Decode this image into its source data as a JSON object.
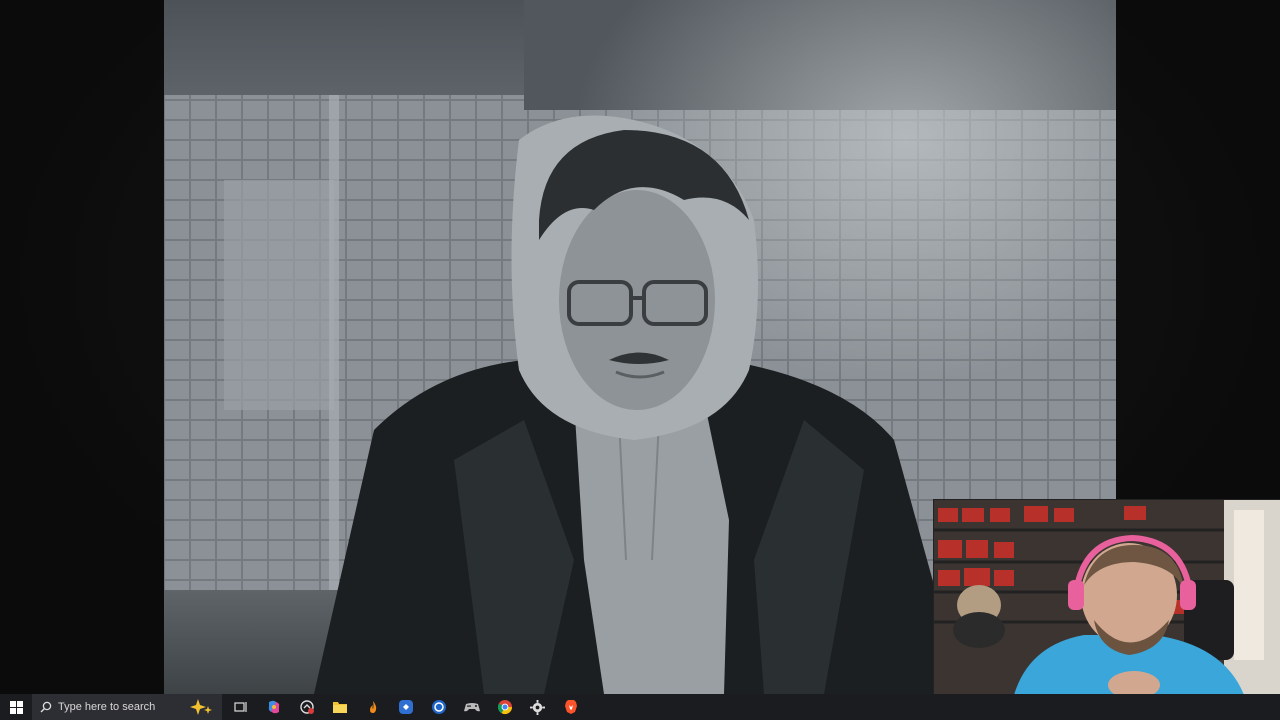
{
  "taskbar": {
    "search_placeholder": "Type here to search",
    "icons": [
      "windows-start-icon",
      "task-view-icon",
      "copilot-icon",
      "snipping-tool-icon",
      "file-explorer-icon",
      "fire-app-icon",
      "app-blue-icon",
      "app-blue2-icon",
      "game-controller-icon",
      "chrome-icon",
      "settings-gear-icon",
      "brave-icon"
    ]
  },
  "colors": {
    "taskbar_bg": "#1b1c1f",
    "search_bg": "#2d2e33"
  }
}
